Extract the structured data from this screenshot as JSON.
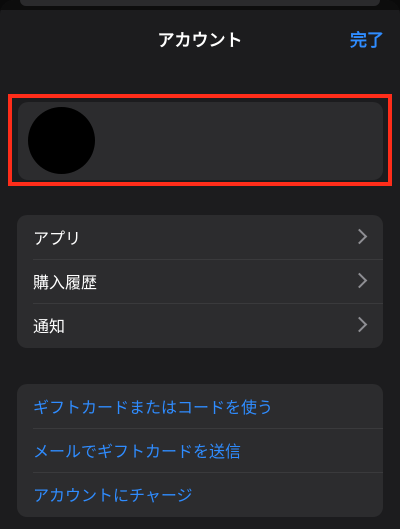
{
  "header": {
    "title": "アカウント",
    "done_label": "完了"
  },
  "menu": {
    "items": [
      {
        "label": "アプリ",
        "icon": "chevron-right-icon"
      },
      {
        "label": "購入履歴",
        "icon": "chevron-right-icon"
      },
      {
        "label": "通知",
        "icon": "chevron-right-icon"
      }
    ]
  },
  "links": {
    "items": [
      {
        "label": "ギフトカードまたはコードを使う"
      },
      {
        "label": "メールでギフトカードを送信"
      },
      {
        "label": "アカウントにチャージ"
      }
    ]
  },
  "colors": {
    "accent": "#2f8cff",
    "highlight_border": "#ff2d1a",
    "background": "#1c1c1e",
    "card": "#2c2c2e"
  }
}
